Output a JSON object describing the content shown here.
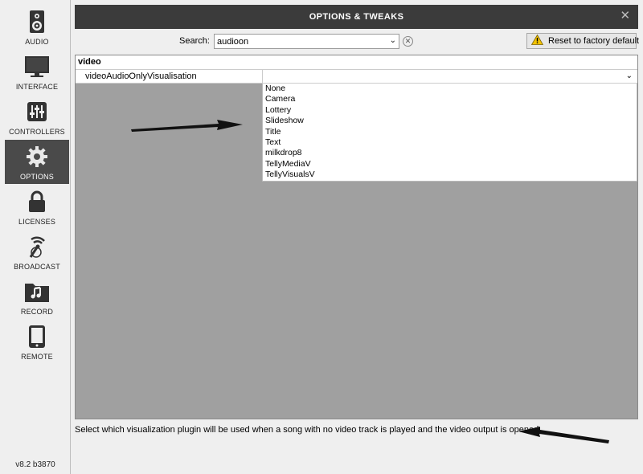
{
  "sidebar": {
    "items": [
      {
        "label": "AUDIO",
        "icon": "speaker-icon"
      },
      {
        "label": "INTERFACE",
        "icon": "monitor-icon"
      },
      {
        "label": "CONTROLLERS",
        "icon": "sliders-icon"
      },
      {
        "label": "OPTIONS",
        "icon": "gear-icon"
      },
      {
        "label": "LICENSES",
        "icon": "lock-icon"
      },
      {
        "label": "BROADCAST",
        "icon": "broadcast-icon"
      },
      {
        "label": "RECORD",
        "icon": "music-folder-icon"
      },
      {
        "label": "REMOTE",
        "icon": "tablet-icon"
      }
    ],
    "active": "OPTIONS",
    "version": "v8.2 b3870"
  },
  "window": {
    "title": "OPTIONS & TWEAKS",
    "close_glyph": "✕"
  },
  "search": {
    "label": "Search:",
    "value": "audioon",
    "dropdown_glyph": "⌄",
    "clear_glyph": "✕"
  },
  "toolbar": {
    "reset_label": "Reset to factory default",
    "reset_icon": "warning-icon"
  },
  "options": {
    "section": "video",
    "rows": [
      {
        "name": "videoAudioOnlyVisualisation",
        "value": ""
      }
    ],
    "dropdown_glyph": "⌄",
    "dropdown_options": [
      "None",
      "Camera",
      "Lottery",
      "Slideshow",
      "Title",
      "Text",
      "milkdrop8",
      "TellyMediaV",
      "TellyVisualsV"
    ]
  },
  "description": "Select which visualization plugin will be used when a song with no video track is played and the video output is opened",
  "colors": {
    "sidebar_active": "#4a4a4a",
    "titlebar": "#3b3b3b",
    "content_bg": "#a0a0a0",
    "warning": "#f2c200",
    "annotation_arrow": "#000000"
  }
}
